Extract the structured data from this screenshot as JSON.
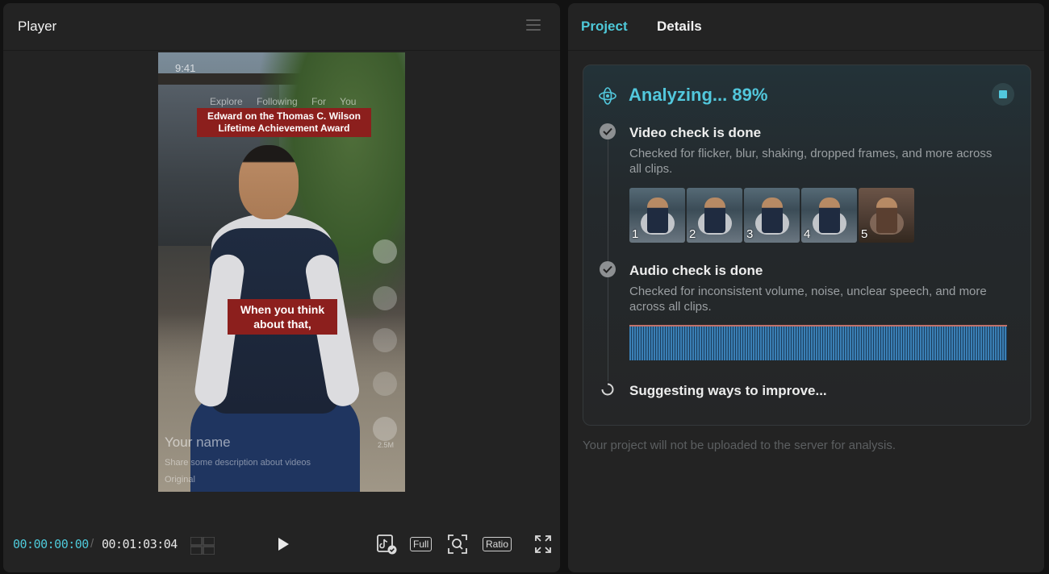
{
  "player": {
    "title": "Player",
    "video": {
      "status_time": "9:41",
      "nav": "Explore  Following  For You",
      "caption_top": "Edward on the Thomas C. Wilson Lifetime Achievement Award",
      "caption_mid": "When you think about that,",
      "username": "Your name",
      "description": "Share some description about videos",
      "sound": "Original",
      "share_count": "2.5M"
    },
    "controls": {
      "current_time": "00:00:00:00",
      "separator": "/",
      "total_time": "00:01:03:04",
      "full_label": "Full",
      "ratio_label": "Ratio"
    }
  },
  "project": {
    "tabs": [
      "Project",
      "Details"
    ],
    "analyzing": "Analyzing... 89%",
    "video_check": {
      "title": "Video check is done",
      "desc": "Checked for flicker, blur, shaking, dropped frames, and more across all clips."
    },
    "clips": [
      "1",
      "2",
      "3",
      "4",
      "5"
    ],
    "audio_check": {
      "title": "Audio check is done",
      "desc": "Checked for inconsistent volume, noise, unclear speech, and more across all clips."
    },
    "suggesting": "Suggesting ways to improve...",
    "notice": "Your project will not be uploaded to the server for analysis."
  },
  "colors": {
    "accent": "#52c7dc",
    "panel_bg": "#232323",
    "caption_red": "#8c1f1d",
    "waveform": "#3a7fb5"
  }
}
